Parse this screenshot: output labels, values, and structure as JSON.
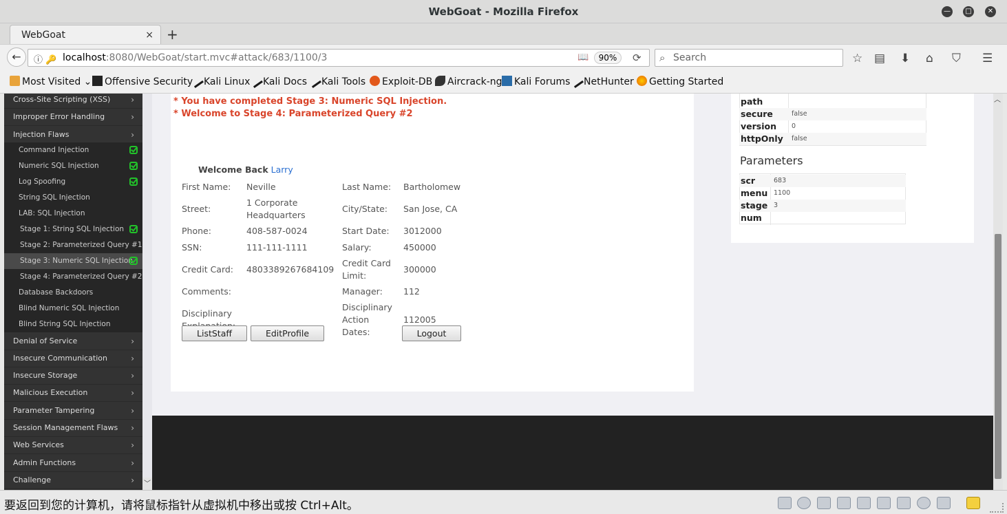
{
  "window": {
    "title": "WebGoat - Mozilla Firefox"
  },
  "tab": {
    "label": "WebGoat",
    "close": "×",
    "new_tab": "+"
  },
  "navbar": {
    "url_host": "localhost",
    "url_rest": ":8080/WebGoat/start.mvc#attack/683/1100/3",
    "zoom": "90%",
    "search_placeholder": "Search"
  },
  "bookmarks": [
    {
      "label": "Most Visited",
      "icon": "folder-icon",
      "color": "#e8a33a"
    },
    {
      "label": "Offensive Security",
      "icon": "offsec-icon",
      "color": "#222222"
    },
    {
      "label": "Kali Linux",
      "icon": "kali-dragon-icon",
      "color": "#1a1a1a"
    },
    {
      "label": "Kali Docs",
      "icon": "kali-dragon-icon",
      "color": "#1a1a1a"
    },
    {
      "label": "Kali Tools",
      "icon": "kali-dragon-icon",
      "color": "#1a1a1a"
    },
    {
      "label": "Exploit-DB",
      "icon": "exploit-db-icon",
      "color": "#e2581b"
    },
    {
      "label": "Aircrack-ng",
      "icon": "aircrack-icon",
      "color": "#333333"
    },
    {
      "label": "Kali Forums",
      "icon": "kali-forums-icon",
      "color": "#2a6ca8"
    },
    {
      "label": "NetHunter",
      "icon": "kali-dragon-icon",
      "color": "#1a1a1a"
    },
    {
      "label": "Getting Started",
      "icon": "firefox-icon",
      "color": "#e66000"
    }
  ],
  "sidebar": {
    "items": [
      {
        "label": "Cross-Site Scripting (XSS)"
      },
      {
        "label": "Improper Error Handling"
      },
      {
        "label": "Injection Flaws"
      }
    ],
    "injection_sub": [
      {
        "label": "Command Injection",
        "done": true
      },
      {
        "label": "Numeric SQL Injection",
        "done": true
      },
      {
        "label": "Log Spoofing",
        "done": true
      },
      {
        "label": "String SQL Injection",
        "done": false
      },
      {
        "label": "LAB: SQL Injection",
        "done": false
      },
      {
        "label": "Stage 1: String SQL Injection",
        "done": true
      },
      {
        "label": "Stage 2: Parameterized Query #1",
        "done": false
      },
      {
        "label": "Stage 3: Numeric SQL Injection",
        "done": true
      },
      {
        "label": "Stage 4: Parameterized Query #2",
        "done": false
      },
      {
        "label": "Database Backdoors",
        "done": false
      },
      {
        "label": "Blind Numeric SQL Injection",
        "done": false
      },
      {
        "label": "Blind String SQL Injection",
        "done": false
      }
    ],
    "items_after": [
      {
        "label": "Denial of Service"
      },
      {
        "label": "Insecure Communication"
      },
      {
        "label": "Insecure Storage"
      },
      {
        "label": "Malicious Execution"
      },
      {
        "label": "Parameter Tampering"
      },
      {
        "label": "Session Management Flaws"
      },
      {
        "label": "Web Services"
      },
      {
        "label": "Admin Functions"
      },
      {
        "label": "Challenge"
      }
    ]
  },
  "messages": {
    "completed": "* You have completed Stage 3: Numeric SQL Injection.",
    "welcome_stage": "* Welcome to Stage 4: Parameterized Query #2"
  },
  "profile": {
    "welcome_prefix": "Welcome Back",
    "user": "Larry",
    "first_name_label": "First Name:",
    "first_name": "Neville",
    "last_name_label": "Last Name:",
    "last_name": "Bartholomew",
    "street_label": "Street:",
    "street_1": "1 Corporate",
    "street_2": "Headquarters",
    "city_label": "City/State:",
    "city": "San Jose, CA",
    "phone_label": "Phone:",
    "phone": "408-587-0024",
    "start_label": "Start Date:",
    "start": "3012000",
    "ssn_label": "SSN:",
    "ssn": "111-111-1111",
    "salary_label": "Salary:",
    "salary": "450000",
    "cc_label": "Credit Card:",
    "cc": "4803389267684109",
    "cc_limit_label_1": "Credit Card",
    "cc_limit_label_2": "Limit:",
    "cc_limit": "300000",
    "comments_label": "Comments:",
    "manager_label": "Manager:",
    "manager": "112",
    "disc_expl_label_1": "Disciplinary",
    "disc_expl_label_2": "Explanation:",
    "disc_action_label_1": "Disciplinary",
    "disc_action_label_2": "Action",
    "disc_action_label_3": "Dates:",
    "disc_action": "112005",
    "btn_liststaff": "ListStaff",
    "btn_editprofile": "EditProfile",
    "btn_logout": "Logout"
  },
  "cookies": {
    "rows": [
      {
        "k": "path",
        "v": ""
      },
      {
        "k": "secure",
        "v": "false"
      },
      {
        "k": "version",
        "v": "0"
      },
      {
        "k": "httpOnly",
        "v": "false"
      }
    ]
  },
  "parameters": {
    "title": "Parameters",
    "rows": [
      {
        "k": "scr",
        "v": "683"
      },
      {
        "k": "menu",
        "v": "1100"
      },
      {
        "k": "stage",
        "v": "3"
      },
      {
        "k": "num",
        "v": ""
      }
    ]
  },
  "statusbar": {
    "hint": "要返回到您的计算机，请将鼠标指针从虚拟机中移出或按 Ctrl+Alt。"
  }
}
